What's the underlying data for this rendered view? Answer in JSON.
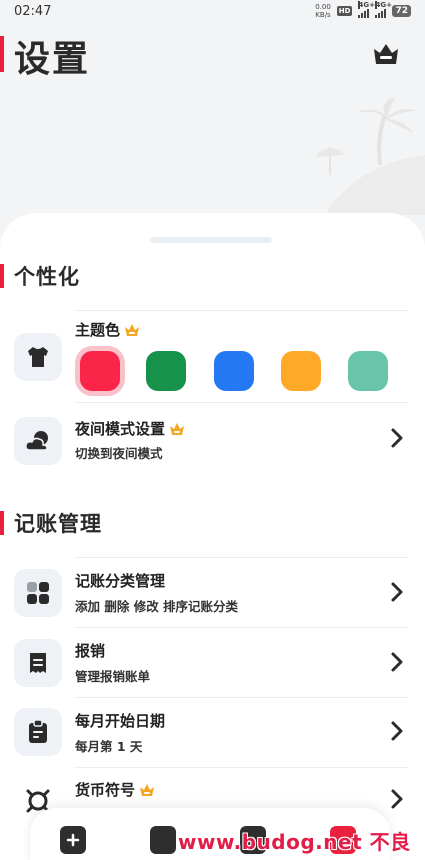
{
  "status_bar": {
    "time": "02:47",
    "net_speed_value": "0.00",
    "net_speed_unit": "KB/s",
    "hd_label": "HD",
    "signal1_label": "4G+",
    "signal2_label": "4G+",
    "battery": "72"
  },
  "header": {
    "title": "设置",
    "premium_icon": "crown-basket-icon"
  },
  "personalization": {
    "section_title": "个性化",
    "theme": {
      "title": "主题色",
      "icon": "shirt-icon",
      "badge_icon": "crown-icon",
      "colors": [
        "#fb2449",
        "#17924a",
        "#2479f2",
        "#ffa928",
        "#69c5a9"
      ],
      "selected_index": 0
    },
    "night_mode": {
      "title": "夜间模式设置",
      "subtitle": "切换到夜间模式",
      "icon": "cloud-moon-icon",
      "badge_icon": "crown-icon"
    }
  },
  "bookkeeping": {
    "section_title": "记账管理",
    "items": [
      {
        "title": "记账分类管理",
        "subtitle": "添加 删除 修改 排序记账分类",
        "icon": "category-grid-icon"
      },
      {
        "title": "报销",
        "subtitle": "管理报销账单",
        "icon": "receipt-icon"
      },
      {
        "title": "每月开始日期",
        "subtitle": "每月第 1 天",
        "icon": "calendar-clipboard-icon"
      },
      {
        "title": "货币符号",
        "subtitle": "",
        "icon": "currency-icon",
        "badge_icon": "crown-icon"
      }
    ]
  },
  "watermark": "www.budog.net 不良社区"
}
